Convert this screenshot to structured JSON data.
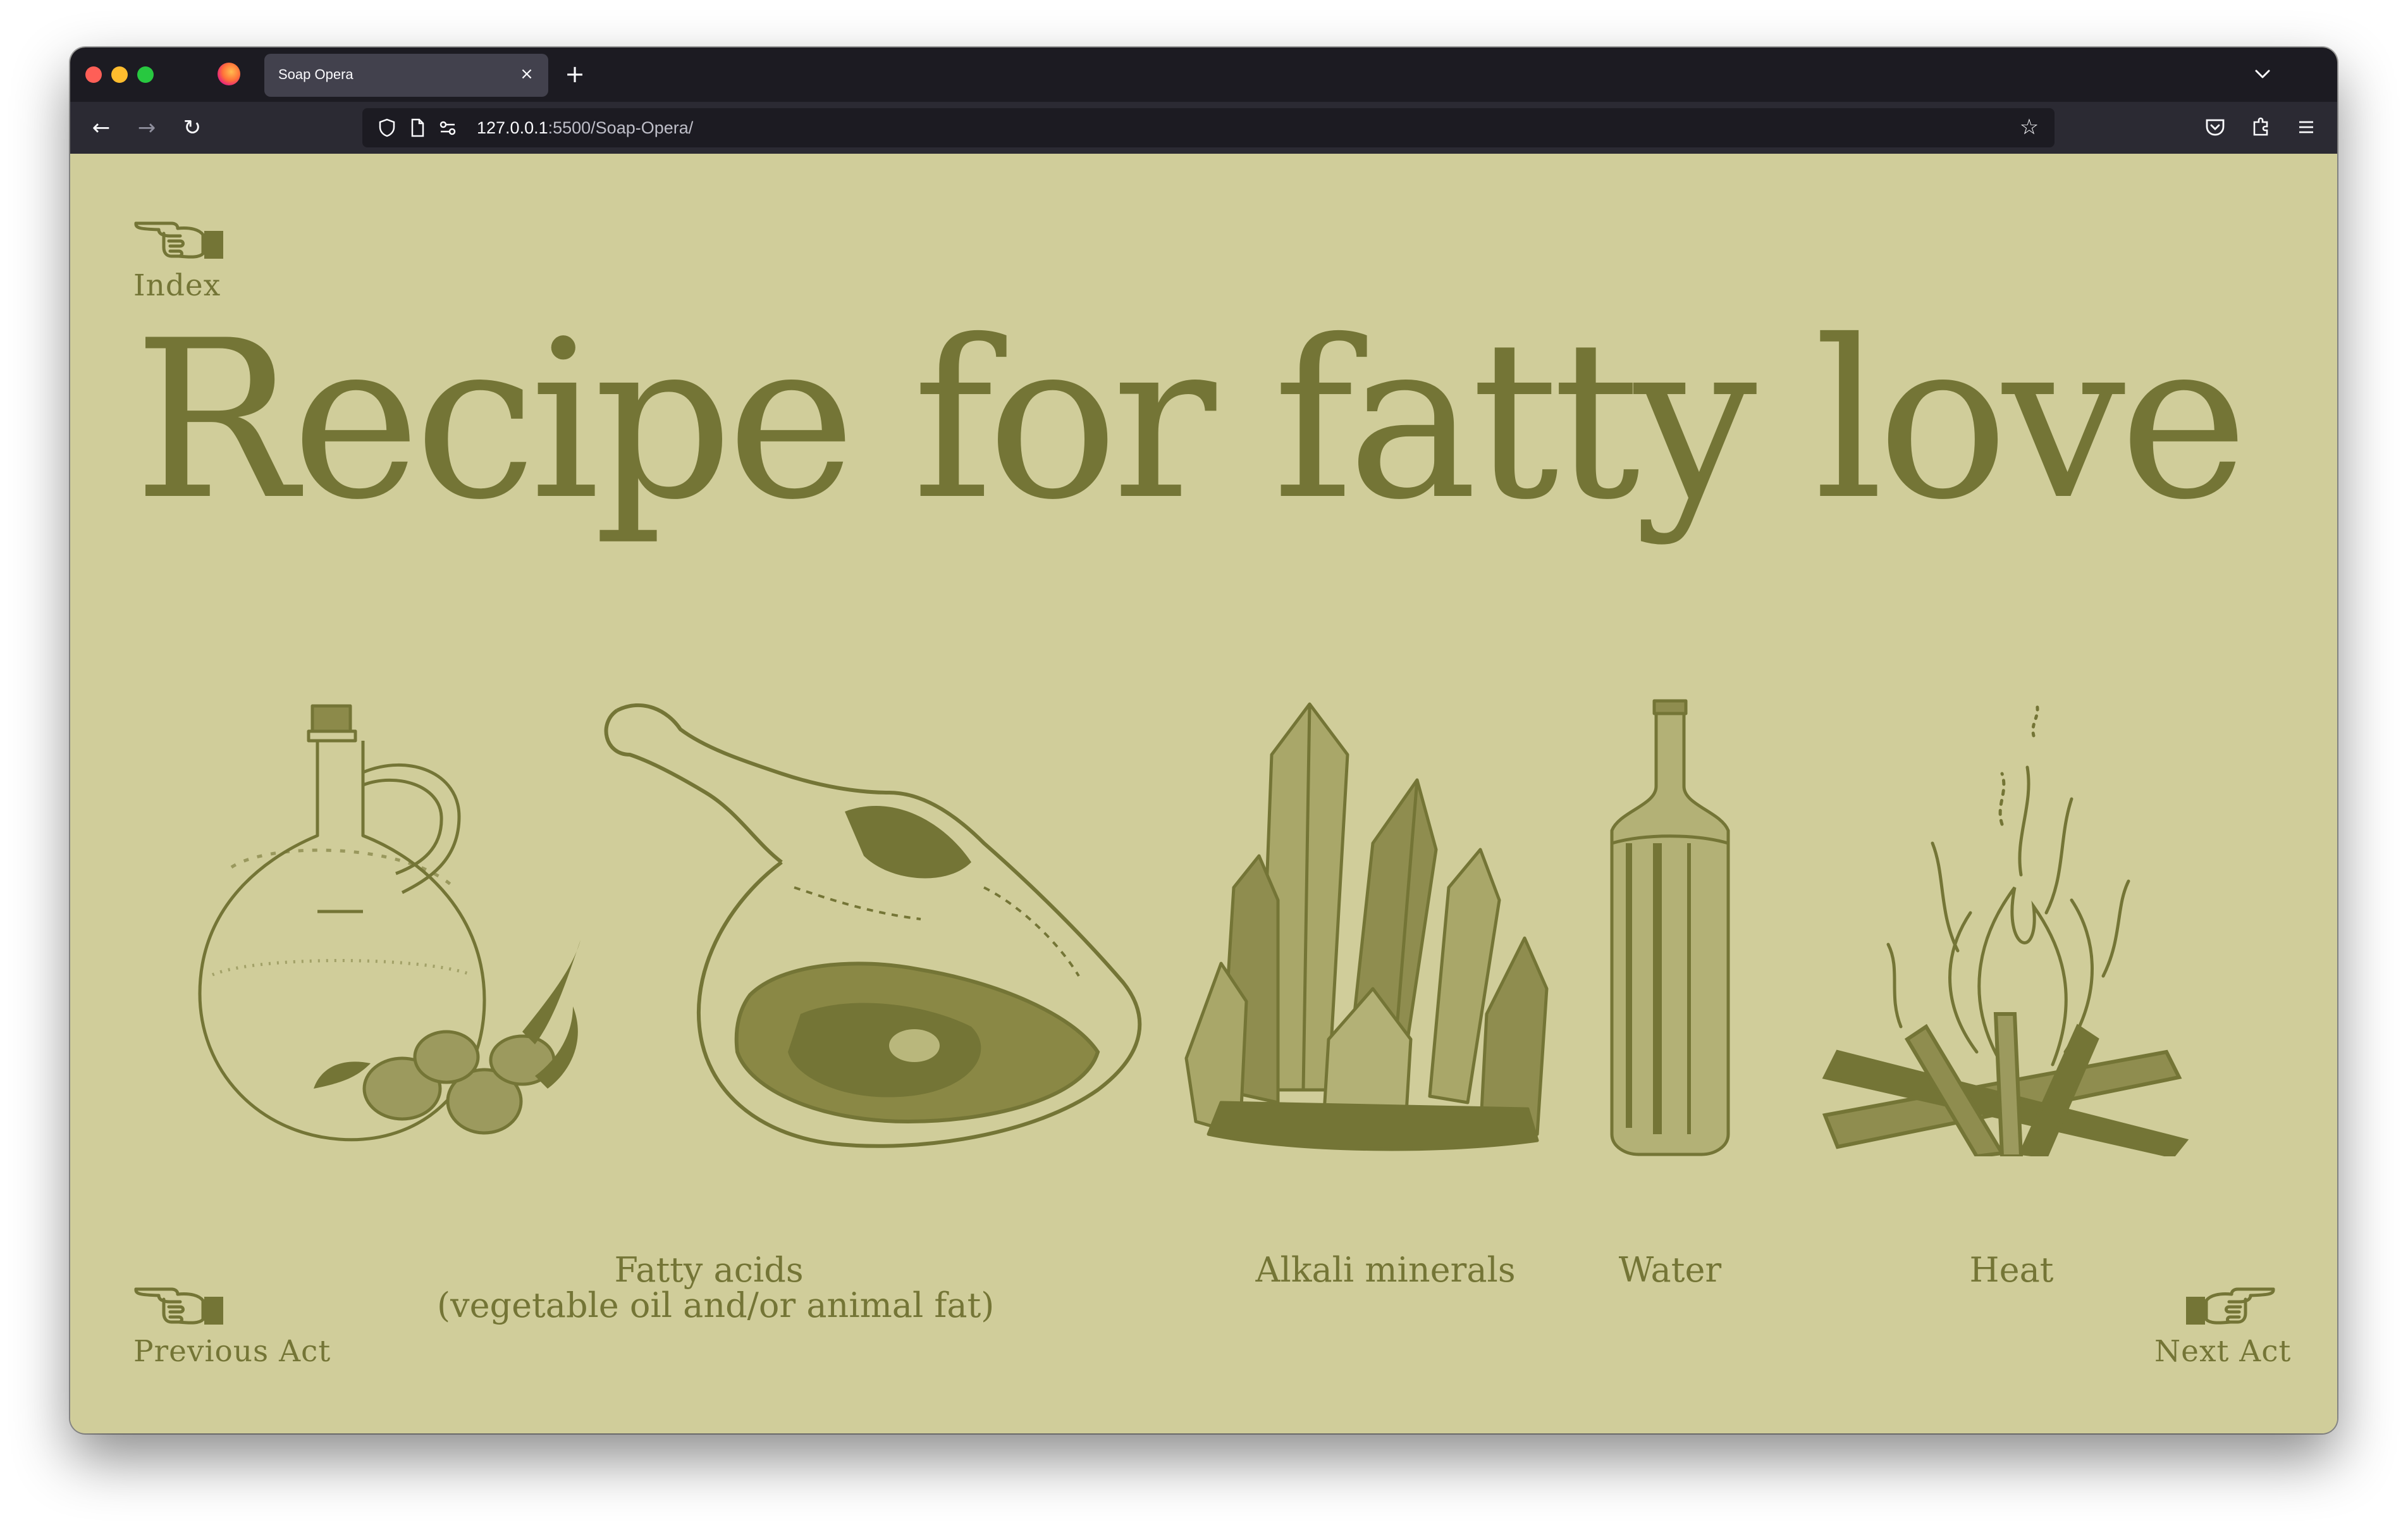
{
  "browser": {
    "tab_title": "Soap Opera",
    "tab_close": "×",
    "new_tab": "+",
    "url_host": "127.0.0.1",
    "url_path": ":5500/Soap-Opera/",
    "back": "←",
    "forward": "→",
    "reload": "↻",
    "bookmark_star": "☆"
  },
  "page": {
    "background": "#d0cd9a",
    "ink": "#747536",
    "index_label": "Index",
    "title": "Recipe for fatty love",
    "ingredients": [
      {
        "caption_line1": "Fatty acids",
        "caption_line2": "(vegetable oil and/or animal fat)",
        "icons": [
          "oil-jug-icon",
          "ham-leg-icon"
        ]
      },
      {
        "caption_line1": "Alkali minerals",
        "icons": [
          "crystal-cluster-icon"
        ]
      },
      {
        "caption_line1": "Water",
        "icons": [
          "bottle-icon"
        ]
      },
      {
        "caption_line1": "Heat",
        "icons": [
          "campfire-icon"
        ]
      }
    ],
    "previous_label": "Previous Act",
    "next_label": "Next Act"
  }
}
